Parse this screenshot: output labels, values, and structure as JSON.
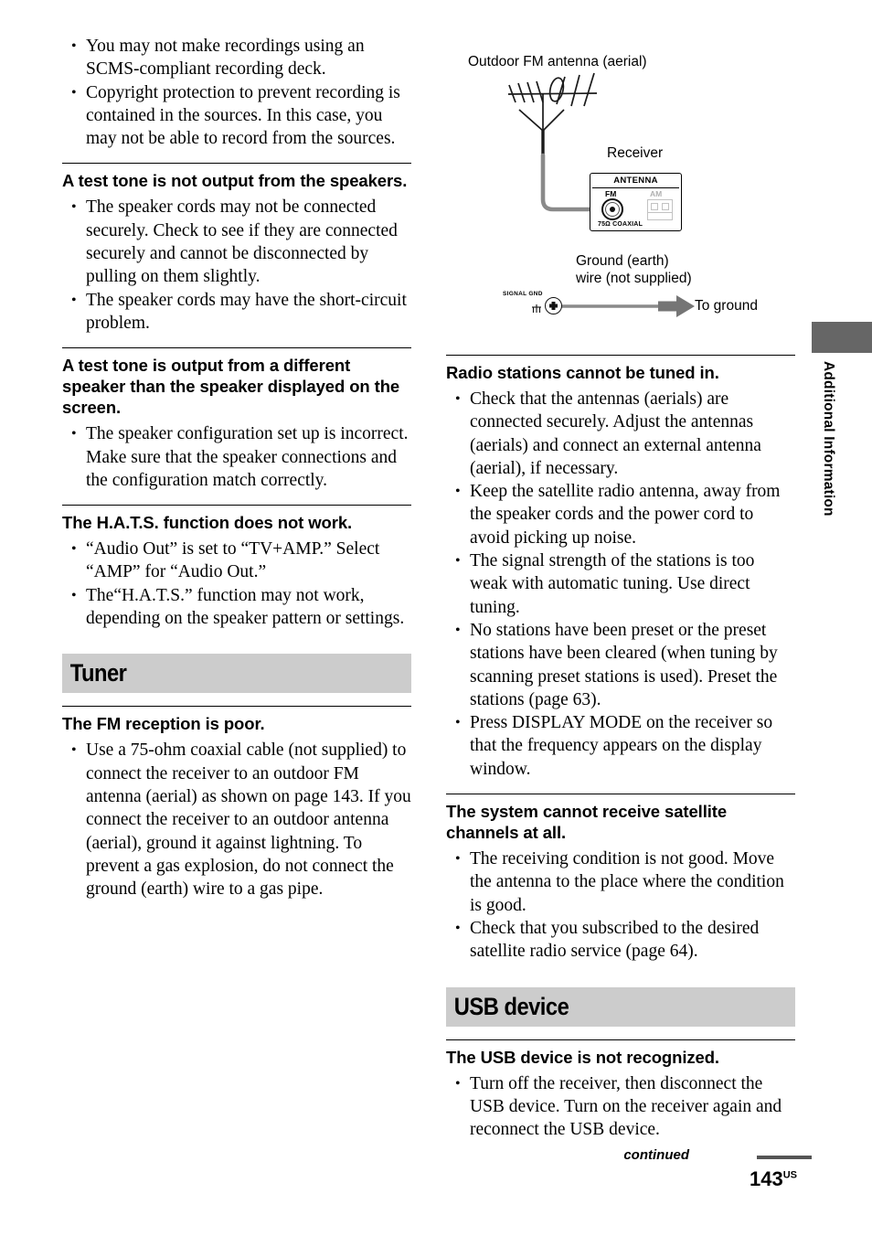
{
  "page": {
    "number": "143",
    "number_suffix": "US",
    "continued_label": "continued",
    "side_tab_label": "Additional Information",
    "side_tab_color": "#666666",
    "section_bar_color": "#cccccc"
  },
  "left_column": {
    "intro_bullets": [
      "You may not make recordings using an SCMS-compliant recording deck.",
      "Copyright protection to prevent recording is contained in the sources. In this case, you may not be able to record from the sources."
    ],
    "blocks": [
      {
        "heading": "A test tone is not output from the speakers.",
        "bullets": [
          "The speaker cords may not be connected securely. Check to see if they are connected securely and cannot be disconnected by pulling on them slightly.",
          "The speaker cords may have the short-circuit problem."
        ]
      },
      {
        "heading": "A test tone is output from a different speaker than the speaker displayed on the screen.",
        "bullets": [
          "The speaker configuration set up is incorrect. Make sure that the speaker connections and the configuration match correctly."
        ]
      },
      {
        "heading": "The H.A.T.S. function does not work.",
        "bullets": [
          "“Audio Out” is set to “TV+AMP.” Select “AMP” for “Audio Out.”",
          "The“H.A.T.S.” function may not work, depending on the speaker pattern or settings."
        ]
      }
    ],
    "section": {
      "title": "Tuner",
      "blocks": [
        {
          "heading": "The FM reception is poor.",
          "bullets": [
            "Use a 75-ohm coaxial cable (not supplied) to connect the receiver to an outdoor FM antenna (aerial) as shown on page 143. If you connect the receiver to an outdoor antenna (aerial), ground it against lightning. To prevent a gas explosion, do not connect the ground (earth) wire to a gas pipe."
          ]
        }
      ]
    }
  },
  "diagram": {
    "name": "fm-antenna-connection-diagram",
    "labels": {
      "outdoor_antenna": "Outdoor FM antenna (aerial)",
      "receiver": "Receiver",
      "ground_wire": "Ground (earth)\nwire (not supplied)",
      "ground_wire_line1": "Ground (earth)",
      "ground_wire_line2": "wire (not supplied)",
      "to_ground": "To ground"
    },
    "connector_panel": {
      "title": "ANTENNA",
      "fm_label": "FM",
      "am_label": "AM",
      "coaxial_label": "75Ω COAXIAL"
    },
    "ground_terminal_label": "SIGNAL GND",
    "cable_color": "#8a8a8a",
    "arrow_color": "#757575"
  },
  "right_column": {
    "blocks": [
      {
        "heading": "Radio stations cannot be tuned in.",
        "bullets": [
          "Check that the antennas (aerials) are connected securely. Adjust the antennas (aerials) and connect an external antenna (aerial), if necessary.",
          "Keep the satellite radio antenna, away from the speaker cords and the power cord to avoid picking up noise.",
          "The signal strength of the stations is too weak with automatic tuning. Use direct tuning.",
          "No stations have been preset or the preset stations have been cleared (when tuning by scanning preset stations is used). Preset the stations (page 63).",
          "Press DISPLAY MODE on the receiver so that the frequency appears on the display window."
        ]
      },
      {
        "heading": "The system cannot receive satellite channels at all.",
        "bullets": [
          "The receiving condition is not good. Move the antenna to the place where the condition is good.",
          "Check that you subscribed to the desired satellite radio service (page 64)."
        ]
      }
    ],
    "section": {
      "title": "USB device",
      "blocks": [
        {
          "heading": "The USB device is not recognized.",
          "bullets": [
            "Turn off the receiver, then disconnect the USB device. Turn on the receiver again and reconnect the USB device."
          ]
        }
      ]
    }
  }
}
